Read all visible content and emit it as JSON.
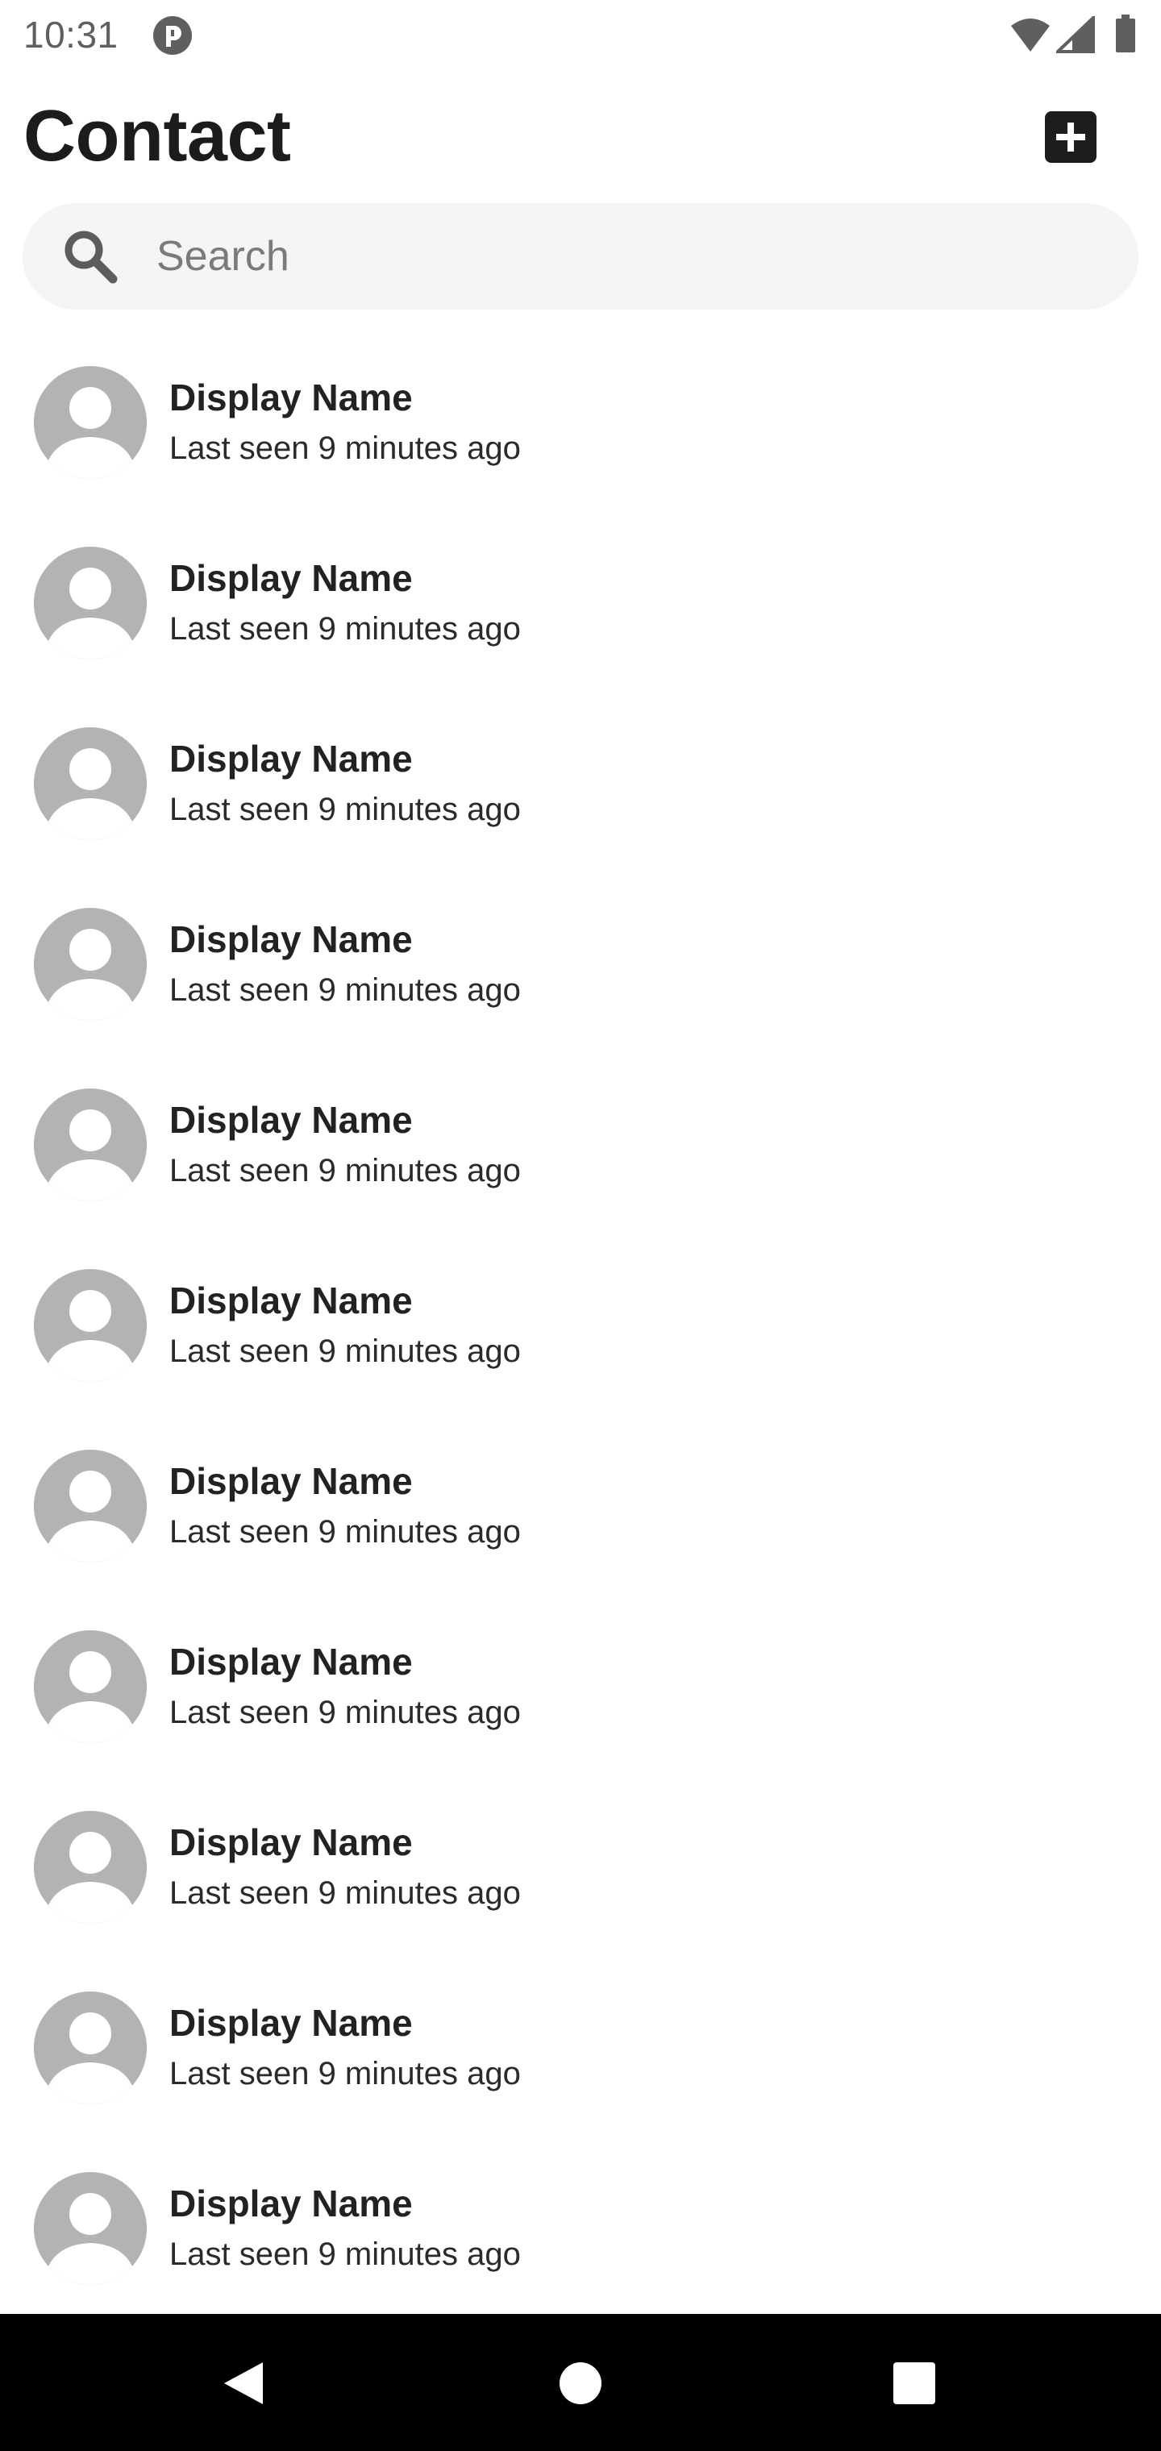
{
  "status_bar": {
    "time": "10:31",
    "icons": [
      "app-notification-icon",
      "wifi-icon",
      "cell-signal-icon",
      "battery-icon"
    ]
  },
  "header": {
    "title": "Contact",
    "add_icon": "plus-square-icon"
  },
  "search": {
    "placeholder": "Search",
    "value": "",
    "icon": "search-icon"
  },
  "contacts": [
    {
      "name": "Display Name",
      "status": "Last seen 9 minutes ago"
    },
    {
      "name": "Display Name",
      "status": "Last seen 9 minutes ago"
    },
    {
      "name": "Display Name",
      "status": "Last seen 9 minutes ago"
    },
    {
      "name": "Display Name",
      "status": "Last seen 9 minutes ago"
    },
    {
      "name": "Display Name",
      "status": "Last seen 9 minutes ago"
    },
    {
      "name": "Display Name",
      "status": "Last seen 9 minutes ago"
    },
    {
      "name": "Display Name",
      "status": "Last seen 9 minutes ago"
    },
    {
      "name": "Display Name",
      "status": "Last seen 9 minutes ago"
    },
    {
      "name": "Display Name",
      "status": "Last seen 9 minutes ago"
    },
    {
      "name": "Display Name",
      "status": "Last seen 9 minutes ago"
    },
    {
      "name": "Display Name",
      "status": "Last seen 9 minutes ago"
    }
  ],
  "nav_bar": {
    "icons": [
      "back-icon",
      "home-icon",
      "recents-icon"
    ]
  },
  "colors": {
    "avatar_bg": "#b3b3b3",
    "search_bg": "#f4f4f4",
    "add_button_bg": "#1d1d1d",
    "nav_bar_bg": "#000000"
  }
}
